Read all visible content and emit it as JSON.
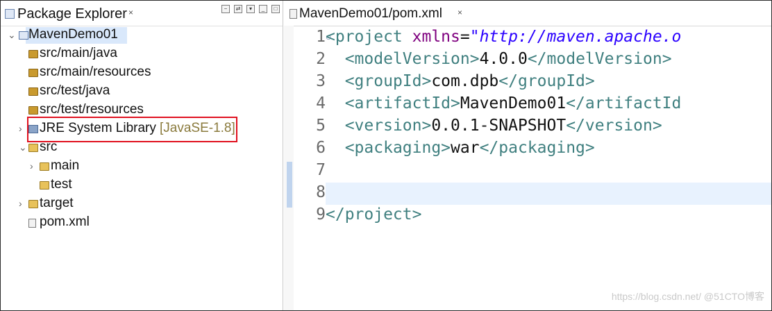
{
  "left_view": {
    "tab_title": "Package Explorer",
    "close_glyph": "×",
    "icons": [
      "package-explorer-icon",
      "collapse-icon",
      "link-icon",
      "filter-icon",
      "minimize-icon",
      "maximize-icon"
    ]
  },
  "tree": {
    "project": {
      "label": "MavenDemo01"
    },
    "src_main_java": {
      "label": "src/main/java"
    },
    "src_main_resources": {
      "label": "src/main/resources"
    },
    "src_test_java": {
      "label": "src/test/java"
    },
    "src_test_resources": {
      "label": "src/test/resources"
    },
    "jre": {
      "label": "JRE System Library",
      "version": "[JavaSE-1.8]"
    },
    "src": {
      "label": "src"
    },
    "main": {
      "label": "main"
    },
    "test": {
      "label": "test"
    },
    "target": {
      "label": "target"
    },
    "pom": {
      "label": "pom.xml"
    }
  },
  "editor": {
    "tab_title": "MavenDemo01/pom.xml",
    "close_glyph": "×",
    "line_numbers": [
      "1",
      "2",
      "3",
      "4",
      "5",
      "6",
      "7",
      "8",
      "9"
    ],
    "l1": {
      "open": "<project ",
      "attr": "xmlns",
      "eq": "=",
      "val": "\"http://maven.apache.o"
    },
    "l2": {
      "open": "<modelVersion>",
      "text": "4.0.0",
      "close": "</modelVersion>"
    },
    "l3": {
      "open": "<groupId>",
      "text": "com.dpb",
      "close": "</groupId>"
    },
    "l4": {
      "open": "<artifactId>",
      "text": "MavenDemo01",
      "close": "</artifactId"
    },
    "l5": {
      "open": "<version>",
      "text": "0.0.1-SNAPSHOT",
      "close": "</version>"
    },
    "l6": {
      "open": "<packaging>",
      "text": "war",
      "close": "</packaging>"
    },
    "l9": {
      "close": "</project>"
    }
  },
  "watermark": "https://blog.csdn.net/ @51CTO博客",
  "colors": {
    "tag": "#3f7f7f",
    "attr": "#7f007f",
    "value": "#2a00ff",
    "highlight_border": "#e0101e",
    "selection": "#d9e8fb"
  }
}
